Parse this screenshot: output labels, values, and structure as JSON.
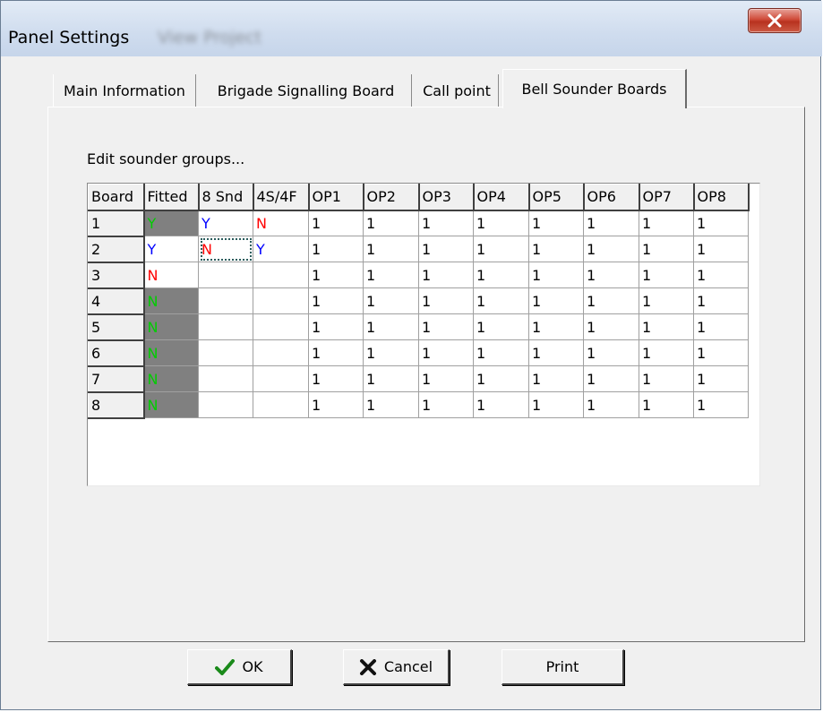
{
  "window": {
    "title": "Panel Settings",
    "title_suffix": "View Project",
    "close_label": "X"
  },
  "tabs": [
    {
      "label": "Main Information",
      "active": false
    },
    {
      "label": "Brigade Signalling Board",
      "active": false
    },
    {
      "label": "Call point",
      "active": false
    },
    {
      "label": "Bell Sounder Boards",
      "active": true
    }
  ],
  "content": {
    "instruction": "Edit sounder groups..."
  },
  "grid": {
    "headers": [
      "Board",
      "Fitted",
      "8 Snd",
      "4S/4F",
      "OP1",
      "OP2",
      "OP3",
      "OP4",
      "OP5",
      "OP6",
      "OP7",
      "OP8"
    ],
    "rows": [
      {
        "board": "1",
        "fitted": "Y",
        "snd8": "Y",
        "s4f4": "N",
        "ops": [
          "1",
          "1",
          "1",
          "1",
          "1",
          "1",
          "1",
          "1"
        ]
      },
      {
        "board": "2",
        "fitted": "Y",
        "snd8": "N",
        "s4f4": "Y",
        "ops": [
          "1",
          "1",
          "1",
          "1",
          "1",
          "1",
          "1",
          "1"
        ]
      },
      {
        "board": "3",
        "fitted": "N",
        "snd8": "",
        "s4f4": "",
        "ops": [
          "1",
          "1",
          "1",
          "1",
          "1",
          "1",
          "1",
          "1"
        ]
      },
      {
        "board": "4",
        "fitted": "N",
        "snd8": "",
        "s4f4": "",
        "ops": [
          "1",
          "1",
          "1",
          "1",
          "1",
          "1",
          "1",
          "1"
        ]
      },
      {
        "board": "5",
        "fitted": "N",
        "snd8": "",
        "s4f4": "",
        "ops": [
          "1",
          "1",
          "1",
          "1",
          "1",
          "1",
          "1",
          "1"
        ]
      },
      {
        "board": "6",
        "fitted": "N",
        "snd8": "",
        "s4f4": "",
        "ops": [
          "1",
          "1",
          "1",
          "1",
          "1",
          "1",
          "1",
          "1"
        ]
      },
      {
        "board": "7",
        "fitted": "N",
        "snd8": "",
        "s4f4": "",
        "ops": [
          "1",
          "1",
          "1",
          "1",
          "1",
          "1",
          "1",
          "1"
        ]
      },
      {
        "board": "8",
        "fitted": "N",
        "snd8": "",
        "s4f4": "",
        "ops": [
          "1",
          "1",
          "1",
          "1",
          "1",
          "1",
          "1",
          "1"
        ]
      }
    ]
  },
  "buttons": {
    "ok": "OK",
    "cancel": "Cancel",
    "print": "Print"
  },
  "colors": {
    "yes_fitted": "#00cc00",
    "yes": "#0000ff",
    "no": "#ff0000",
    "readonly_cell": "#808080"
  }
}
